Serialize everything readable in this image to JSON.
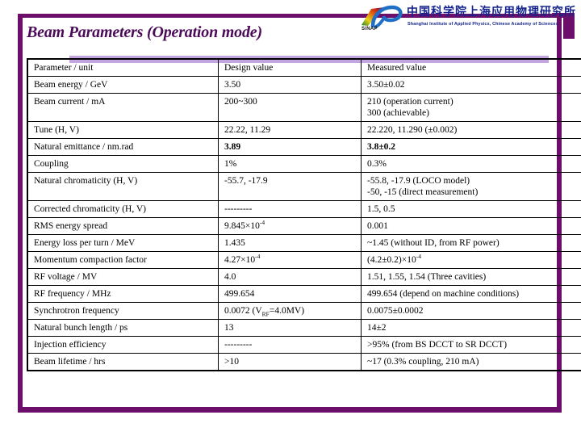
{
  "slide": {
    "title": "Beam Parameters (Operation mode)",
    "frame_color": "#6B0F6B",
    "title_color": "#4B0B58",
    "header_band_color": "#C3A6E0",
    "measured_text_color": "#A32020"
  },
  "logo": {
    "mark_name": "sinap-logo-mark",
    "acronym": "SINAP",
    "chinese_name": "中国科学院上海应用物理研究所",
    "english_name": "Shanghai Institute of Applied Physics, Chinese Academy of Sciences"
  },
  "table": {
    "headers": {
      "parameter": "Parameter / unit",
      "design": "Design value",
      "measured": "Measured value"
    },
    "rows": [
      {
        "parameter": "Beam energy / GeV",
        "design": "3.50",
        "measured": "3.50±0.02",
        "bold": false
      },
      {
        "parameter": "Beam current / mA",
        "design": "200~300",
        "measured_line1": "210 (operation current)",
        "measured_line2": "300 (achievable)",
        "bold": false
      },
      {
        "parameter": "Tune (H, V)",
        "design": "22.22, 11.29",
        "measured": "22.220, 11.290 (±0.002)",
        "bold": false
      },
      {
        "parameter": "Natural emittance / nm.rad",
        "design": "3.89",
        "measured": "3.8±0.2",
        "bold": true
      },
      {
        "parameter": "Coupling",
        "design": "1%",
        "measured": "0.3%",
        "bold": false
      },
      {
        "parameter": "Natural chromaticity (H, V)",
        "design": "-55.7, -17.9",
        "measured_line1": "-55.8, -17.9 (LOCO model)",
        "measured_line2": "-50, -15 (direct measurement)",
        "bold": false
      },
      {
        "parameter": "Corrected chromaticity (H, V)",
        "design": "---------",
        "measured": "1.5, 0.5",
        "bold": false
      },
      {
        "parameter": "RMS energy spread",
        "design_pre": "9.845×10",
        "design_sup": "-4",
        "measured": "0.001",
        "bold": false
      },
      {
        "parameter": "Energy loss per turn / MeV",
        "design": "1.435",
        "measured": "~1.45 (without ID, from RF power)",
        "bold": false
      },
      {
        "parameter": "Momentum compaction factor",
        "design_pre": "4.27×10",
        "design_sup": "-4",
        "measured_pre": "(4.2±0.2)×10",
        "measured_sup": "-4",
        "bold": false
      },
      {
        "parameter": "RF voltage / MV",
        "design": "4.0",
        "measured": "1.51, 1.55, 1.54 (Three cavities)",
        "bold": false
      },
      {
        "parameter": "RF frequency / MHz",
        "design": "499.654",
        "measured": "499.654 (depend on machine conditions)",
        "bold": false
      },
      {
        "parameter": "Synchrotron frequency",
        "design_pre": "0.0072 (V",
        "design_sub": "RF",
        "design_post": "=4.0MV)",
        "measured": "0.0075±0.0002",
        "bold": false
      },
      {
        "parameter": "Natural bunch length / ps",
        "design": "13",
        "measured": "14±2",
        "bold": false
      },
      {
        "parameter": "Injection efficiency",
        "design": "---------",
        "measured": ">95% (from BS DCCT to SR DCCT)",
        "bold": false
      },
      {
        "parameter": "Beam lifetime / hrs",
        "design": ">10",
        "measured": "~17 (0.3% coupling, 210 mA)",
        "bold": false
      }
    ]
  }
}
